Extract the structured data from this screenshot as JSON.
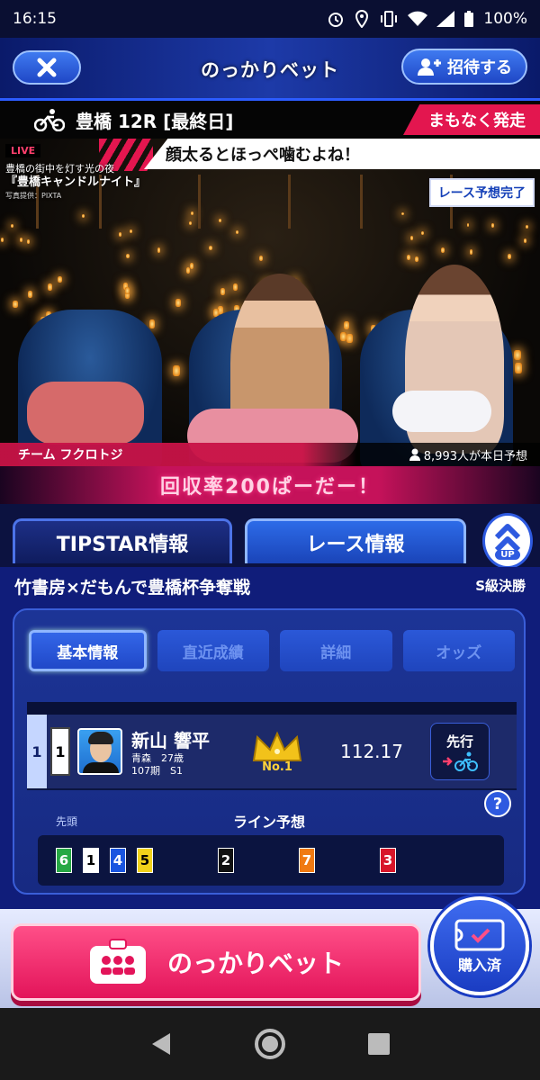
{
  "status_bar": {
    "time": "16:15",
    "battery": "100%"
  },
  "header": {
    "title": "のっかりベット",
    "invite_label": "招待する"
  },
  "race": {
    "title": "豊橋 12R [最終日]",
    "status": "まもなく発走"
  },
  "video": {
    "live_label": "LIVE",
    "caption_line1": "豊橋の街中を灯す光の夜",
    "caption_line2": "『豊橋キャンドルナイト』",
    "caption_credit": "写真提供：PIXTA",
    "ticker": "顔太るとほっぺ噛むよね！",
    "prediction_badge": "レース予想完了",
    "team_name": "チーム フクロトジ",
    "viewers": "8,993人が本日予想"
  },
  "banner": "回収率200ぱーだー！",
  "tabs": {
    "tab1": "TIPSTAR情報",
    "tab2": "レース情報",
    "up_label": "UP"
  },
  "race_info": {
    "name": "竹書房×だもんで豊橋杯争奪戦",
    "grade": "S級決勝",
    "subtabs": [
      "基本情報",
      "直近成績",
      "詳細",
      "オッズ"
    ],
    "entry": {
      "lane": "1",
      "frame": "1",
      "name": "新山 響平",
      "pref_age": "青森　27歳",
      "period_class": "107期　S1",
      "rank_label": "No.1",
      "score": "112.17",
      "style": "先行"
    },
    "help_label": "?",
    "line_head": "先頭",
    "line_title": "ライン予想",
    "line_chips": [
      {
        "num": "6",
        "bg": "#27a844",
        "fg": "#ffffff"
      },
      {
        "num": "1",
        "bg": "#ffffff",
        "fg": "#000000"
      },
      {
        "num": "4",
        "bg": "#1a55e0",
        "fg": "#ffffff"
      },
      {
        "num": "5",
        "bg": "#f2d21a",
        "fg": "#000000"
      },
      {
        "num": "2",
        "bg": "#111111",
        "fg": "#ffffff"
      },
      {
        "num": "7",
        "bg": "#f07a12",
        "fg": "#ffffff"
      },
      {
        "num": "3",
        "bg": "#d8162a",
        "fg": "#ffffff"
      }
    ]
  },
  "bottom": {
    "bet_label": "のっかりベット",
    "purchased_label": "購入済"
  },
  "colors": {
    "accent": "#e3164f",
    "primary": "#1f47c6",
    "bg": "#0c1240"
  }
}
